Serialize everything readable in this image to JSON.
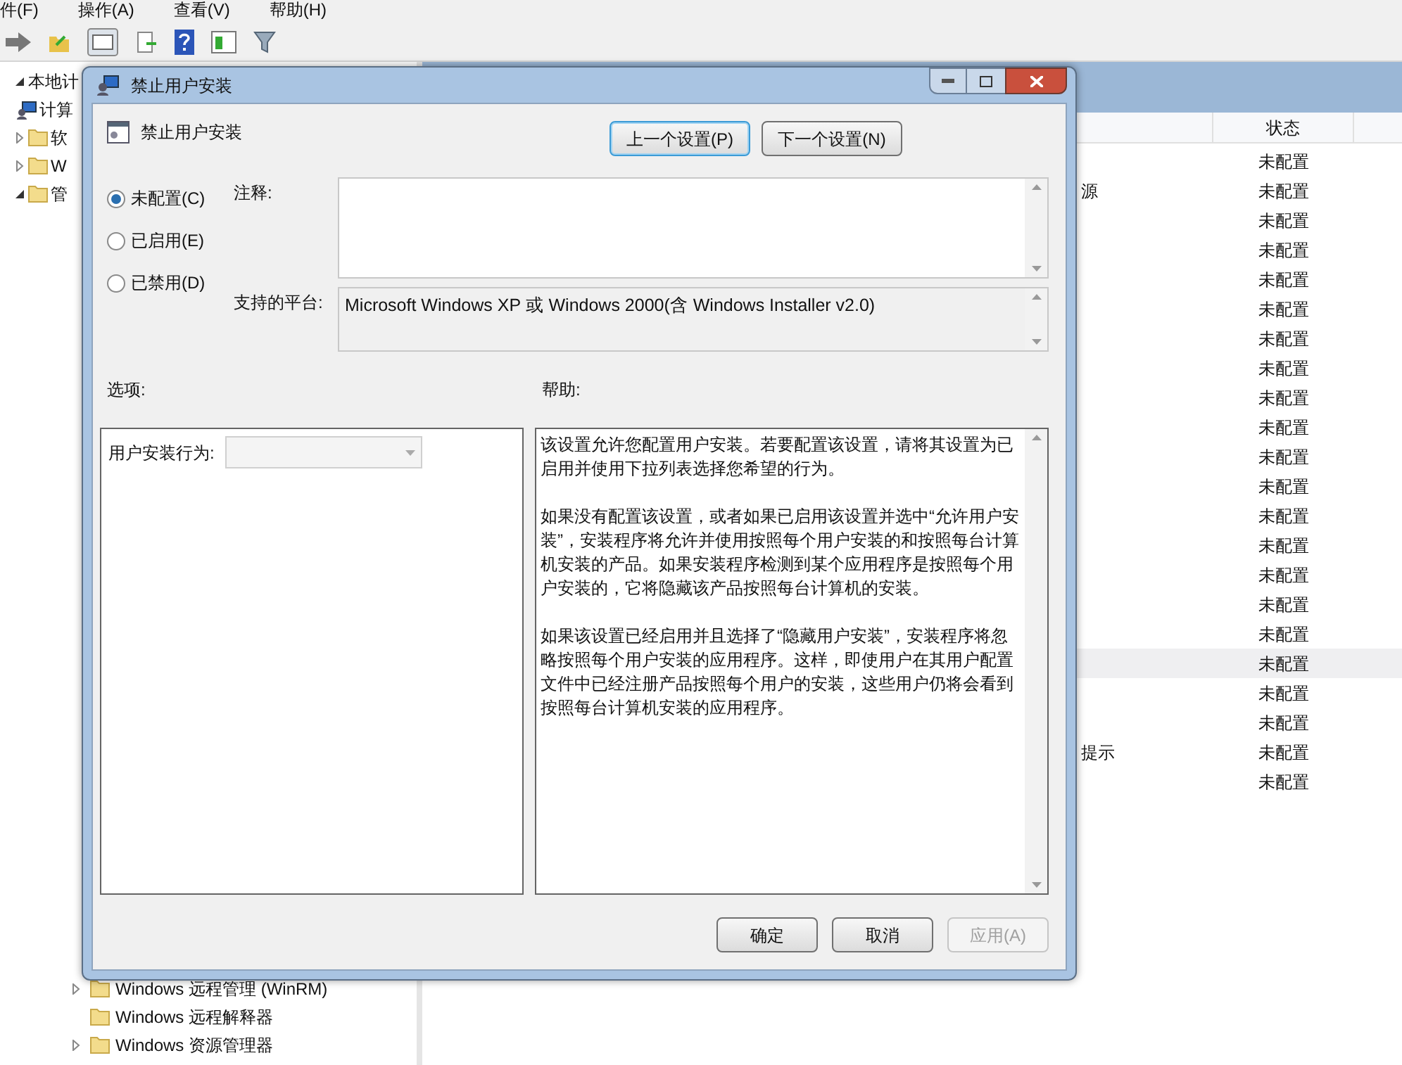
{
  "menu_bar": [
    "件(F)",
    "操作(A)",
    "查看(V)",
    "帮助(H)"
  ],
  "sidebar": {
    "items": [
      {
        "label": "本地计",
        "expanded": true,
        "children": [
          {
            "label": "计算",
            "expanded": true,
            "children": [
              {
                "label": "软",
                "expanded": false
              },
              {
                "label": "W",
                "expanded": false
              },
              {
                "label": "管",
                "expanded": true
              }
            ]
          }
        ]
      }
    ],
    "lower_items": [
      {
        "label": "Windows 远程管理 (WinRM)",
        "expanded": false
      },
      {
        "label": "Windows 远程解释器"
      },
      {
        "label": "Windows 资源管理器",
        "expanded": false
      }
    ]
  },
  "list": {
    "columns": [
      "状态"
    ],
    "rows": [
      {
        "status": "未配置",
        "selected": false
      },
      {
        "name": "源",
        "status": "未配置",
        "selected": false
      },
      {
        "status": "未配置",
        "selected": false
      },
      {
        "status": "未配置",
        "selected": false
      },
      {
        "status": "未配置",
        "selected": false
      },
      {
        "status": "未配置",
        "selected": false
      },
      {
        "status": "未配置",
        "selected": false
      },
      {
        "status": "未配置",
        "selected": false
      },
      {
        "status": "未配置",
        "selected": false
      },
      {
        "status": "未配置",
        "selected": false
      },
      {
        "status": "未配置",
        "selected": false
      },
      {
        "status": "未配置",
        "selected": false
      },
      {
        "status": "未配置",
        "selected": false
      },
      {
        "status": "未配置",
        "selected": false
      },
      {
        "status": "未配置",
        "selected": false
      },
      {
        "status": "未配置",
        "selected": false
      },
      {
        "status": "未配置",
        "selected": false
      },
      {
        "status": "未配置",
        "selected": true
      },
      {
        "status": "未配置",
        "selected": false
      },
      {
        "status": "未配置",
        "selected": false
      },
      {
        "name": "提示",
        "status": "未配置",
        "selected": false
      },
      {
        "status": "未配置",
        "selected": false
      }
    ]
  },
  "dialog": {
    "title": "禁止用户安装",
    "heading": "禁止用户安装",
    "nav_buttons": [
      {
        "label": "上一个设置(P)",
        "focused": true
      },
      {
        "label": "下一个设置(N)",
        "focused": false
      }
    ],
    "radios": [
      {
        "label": "未配置(C)",
        "selected": true
      },
      {
        "label": "已启用(E)",
        "selected": false
      },
      {
        "label": "已禁用(D)",
        "selected": false
      }
    ],
    "comment_label": "注释:",
    "platform_label": "支持的平台:",
    "platform": "Microsoft Windows XP 或 Windows 2000(含 Windows Installer v2.0)",
    "options_label": "选项:",
    "help_label": "帮助:",
    "option": {
      "label": "用户安装行为:",
      "disabled": true
    },
    "help": [
      "该设置允许您配置用户安装。若要配置该设置，请将其设置为已启用并使用下拉列表选择您希望的行为。",
      "如果没有配置该设置，或者如果已启用该设置并选中“允许用户安装”，安装程序将允许并使用按照每个用户安装的和按照每台计算机安装的产品。如果安装程序检测到某个应用程序是按照每个用户安装的，它将隐藏该产品按照每台计算机的安装。",
      "如果该设置已经启用并且选择了“隐藏用户安装”，安装程序将忽略按照每个用户安装的应用程序。这样，即使用户在其用户配置文件中已经注册产品按照每个用户的安装，这些用户仍将会看到按照每台计算机安装的应用程序。"
    ],
    "buttons": [
      {
        "label": "确定",
        "disabled": false
      },
      {
        "label": "取消",
        "disabled": false
      },
      {
        "label": "应用(A)",
        "disabled": true
      }
    ]
  }
}
